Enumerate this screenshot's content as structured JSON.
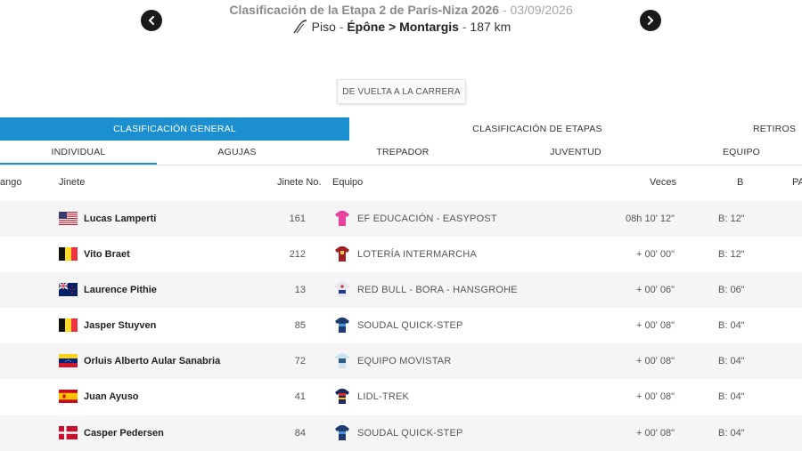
{
  "header": {
    "title": "Clasificación de la Etapa 2 de París-Niza 2026",
    "date_sep": " - ",
    "date": "03/09/2026",
    "stage_type": "Piso",
    "sep1": " - ",
    "route": "Épône > Montargis",
    "sep2": " - ",
    "distance": "187 km"
  },
  "back_button": "DE VUELTA A LA CARRERA",
  "main_tabs": [
    {
      "label": "CLASIFICACIÓN GENERAL",
      "active": true
    },
    {
      "label": "CLASIFICACIÓN DE ETAPAS",
      "active": false
    },
    {
      "label": "RETIROS",
      "active": false
    }
  ],
  "sub_tabs": [
    {
      "label": "INDIVIDUAL",
      "active": true
    },
    {
      "label": "AGUJAS",
      "active": false
    },
    {
      "label": "TREPADOR",
      "active": false
    },
    {
      "label": "JUVENTUD",
      "active": false
    },
    {
      "label": "EQUIPO",
      "active": false
    }
  ],
  "columns": {
    "rank": "ango",
    "rider": "Jinete",
    "number": "Jinete No.",
    "team": "Equipo",
    "time": "Veces",
    "bonus": "B",
    "extra": "PA"
  },
  "rows": [
    {
      "flag": "usa-flag-icon",
      "rider": "Lucas Lamperti",
      "number": "161",
      "jersey": "ef-jersey-icon",
      "team": "EF EDUCACIÓN - EASYPOST",
      "time": "08h 10' 12\"",
      "bonus": "B: 12\""
    },
    {
      "flag": "belgium-flag-icon",
      "rider": "Vito Braet",
      "number": "212",
      "jersey": "intermarche-jersey-icon",
      "team": "LOTERÍA INTERMARCHA",
      "time": "+ 00' 00\"",
      "bonus": "B: 12\""
    },
    {
      "flag": "new-zealand-flag-icon",
      "rider": "Laurence Pithie",
      "number": "13",
      "jersey": "redbull-jersey-icon",
      "team": "RED BULL - BORA - HANSGROHE",
      "time": "+ 00' 06\"",
      "bonus": "B: 06\""
    },
    {
      "flag": "belgium-flag-icon",
      "rider": "Jasper Stuyven",
      "number": "85",
      "jersey": "soudal-jersey-icon",
      "team": "SOUDAL QUICK-STEP",
      "time": "+ 00' 08\"",
      "bonus": "B: 04\""
    },
    {
      "flag": "venezuela-flag-icon",
      "rider": "Orluis Alberto Aular Sanabria",
      "number": "72",
      "jersey": "movistar-jersey-icon",
      "team": "EQUIPO MOVISTAR",
      "time": "+ 00' 08\"",
      "bonus": "B: 04\""
    },
    {
      "flag": "spain-flag-icon",
      "rider": "Juan Ayuso",
      "number": "41",
      "jersey": "lidl-trek-jersey-icon",
      "team": "LIDL-TREK",
      "time": "+ 00' 08\"",
      "bonus": "B: 04\""
    },
    {
      "flag": "denmark-flag-icon",
      "rider": "Casper Pedersen",
      "number": "84",
      "jersey": "soudal-jersey-icon",
      "team": "SOUDAL QUICK-STEP",
      "time": "+ 00' 08\"",
      "bonus": "B: 04\""
    }
  ],
  "colors": {
    "accent": "#1b8fcf",
    "title_gray": "#8a8a8a",
    "row_alt": "#f5f5f5"
  }
}
